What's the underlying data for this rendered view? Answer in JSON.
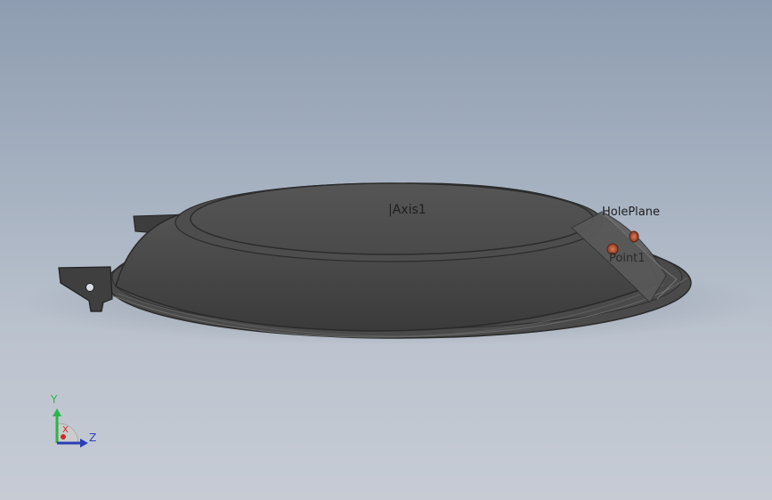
{
  "viewport": {
    "background_top": "#8e9db1",
    "background_bottom": "#c6cbd4",
    "part_color": "#4b4b4b",
    "labels": {
      "axis": "|Axis1",
      "hole_plane": "HolePlane",
      "point": "Point1"
    }
  },
  "triad": {
    "y_label": "Y",
    "z_label": "Z",
    "x_label": "X",
    "y_color": "#2db34a",
    "z_color": "#2a3fb5",
    "x_color": "#cc2a2a"
  }
}
